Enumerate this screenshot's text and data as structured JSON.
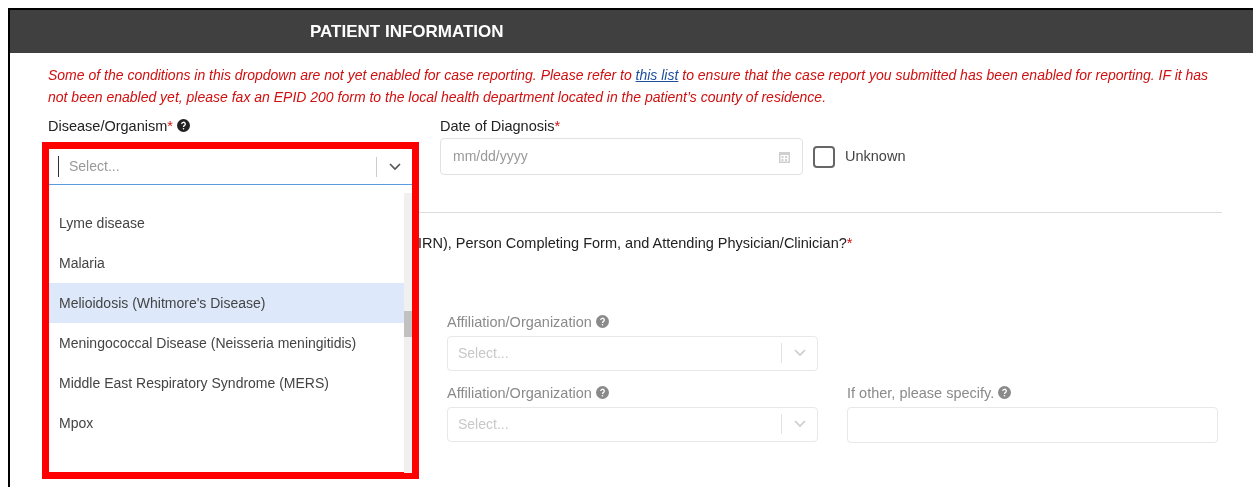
{
  "header": {
    "title": "PATIENT INFORMATION"
  },
  "notice": {
    "before": "Some of the conditions in this dropdown are not yet enabled for case reporting. Please refer to",
    "link": "this list",
    "after": "to ensure that the case report you submitted has been enabled for reporting. IF it has not been enabled yet, please fax an EPID 200 form to the local health department located in the patient’s county of residence."
  },
  "disease": {
    "label": "Disease/Organism",
    "required": "*",
    "placeholder": "Select...",
    "options": [
      {
        "label": "Lyme disease",
        "selected": false
      },
      {
        "label": "Malaria",
        "selected": false
      },
      {
        "label": "Melioidosis (Whitmore's Disease)",
        "selected": true
      },
      {
        "label": "Meningococcal Disease (Neisseria meningitidis)",
        "selected": false
      },
      {
        "label": "Middle East Respiratory Syndrome (MERS)",
        "selected": false
      },
      {
        "label": "Mpox",
        "selected": false
      }
    ]
  },
  "diagnosis_date": {
    "label": "Date of Diagnosis",
    "required": "*",
    "placeholder": "mm/dd/yyyy",
    "unknown": {
      "label": "Unknown",
      "checked": false
    }
  },
  "question": {
    "text": "IRN), Person Completing Form, and Attending Physician/Clinician?",
    "required": "*"
  },
  "affiliation_1": {
    "label": "Affiliation/Organization",
    "placeholder": "Select..."
  },
  "affiliation_2": {
    "label": "Affiliation/Organization",
    "placeholder": "Select..."
  },
  "other": {
    "label": "If other, please specify."
  }
}
